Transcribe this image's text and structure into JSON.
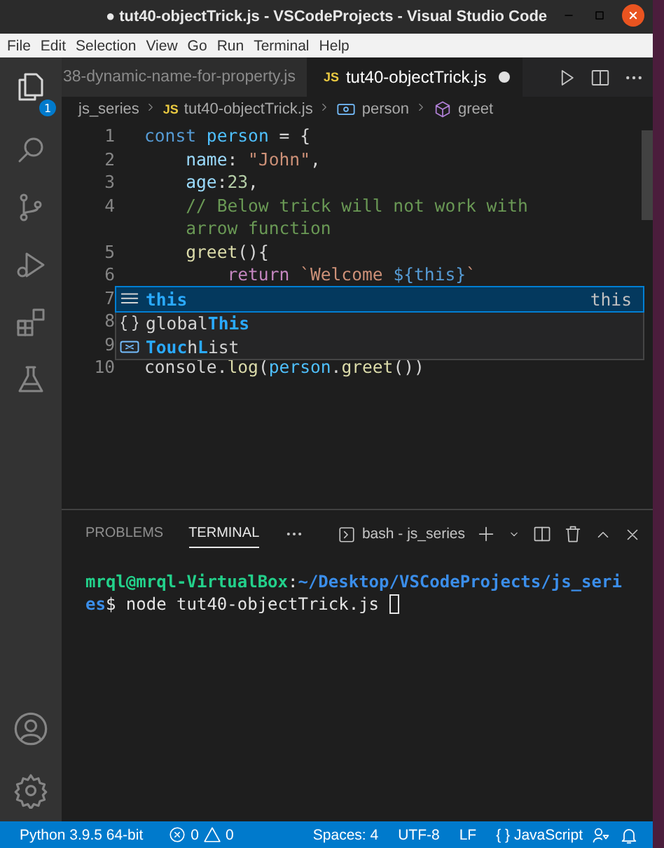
{
  "window": {
    "title": "● tut40-objectTrick.js - VSCodeProjects - Visual Studio Code"
  },
  "menu": [
    "File",
    "Edit",
    "Selection",
    "View",
    "Go",
    "Run",
    "Terminal",
    "Help"
  ],
  "activity_bar": {
    "explorer_badge": "1"
  },
  "tabs": [
    {
      "label": "38-dynamic-name-for-property.js",
      "selected": false,
      "modified": false
    },
    {
      "label": "tut40-objectTrick.js",
      "badge": "JS",
      "selected": true,
      "modified": true
    }
  ],
  "breadcrumb": [
    {
      "kind": "folder",
      "text": "js_series"
    },
    {
      "kind": "file",
      "badge": "JS",
      "text": "tut40-objectTrick.js"
    },
    {
      "kind": "variable",
      "text": "person"
    },
    {
      "kind": "method",
      "text": "greet"
    }
  ],
  "code": [
    {
      "number": "1",
      "tokens": [
        {
          "kind": "keyword",
          "text": "const"
        },
        {
          "kind": "constant",
          "text": " person"
        },
        {
          "kind": "plain",
          "text": " = {"
        }
      ]
    },
    {
      "number": "2",
      "tokens": [
        {
          "kind": "property",
          "text": "    name"
        },
        {
          "kind": "plain",
          "text": ": "
        },
        {
          "kind": "string",
          "text": "\"John\""
        },
        {
          "kind": "plain",
          "text": ","
        }
      ]
    },
    {
      "number": "3",
      "tokens": [
        {
          "kind": "property",
          "text": "    age"
        },
        {
          "kind": "plain",
          "text": ":"
        },
        {
          "kind": "number",
          "text": "23"
        },
        {
          "kind": "plain",
          "text": ","
        }
      ]
    },
    {
      "number": "4",
      "tokens": [
        {
          "kind": "comment",
          "text": "    // Below trick will not work with"
        }
      ]
    },
    {
      "tokens": [
        {
          "kind": "comment",
          "text": "    arrow function"
        }
      ]
    },
    {
      "number": "5",
      "tokens": [
        {
          "kind": "function",
          "text": "    greet"
        },
        {
          "kind": "plain",
          "text": "(){"
        }
      ]
    },
    {
      "number": "6",
      "tokens": [
        {
          "kind": "control",
          "text": "        return"
        },
        {
          "kind": "string",
          "text": " `Welcome "
        },
        {
          "kind": "keyword",
          "text": "${this}"
        },
        {
          "kind": "string",
          "text": "`"
        }
      ]
    },
    {
      "number": "7"
    },
    {
      "number": "8"
    },
    {
      "number": "9"
    },
    {
      "number": "10",
      "tokens": [
        {
          "kind": "plain",
          "text": "console"
        },
        {
          "kind": "plain",
          "text": "."
        },
        {
          "kind": "function",
          "text": "log"
        },
        {
          "kind": "plain",
          "text": "("
        },
        {
          "kind": "constant",
          "text": "person"
        },
        {
          "kind": "plain",
          "text": "."
        },
        {
          "kind": "function",
          "text": "greet"
        },
        {
          "kind": "plain",
          "text": "())"
        }
      ]
    }
  ],
  "suggestions": [
    {
      "kind": "keyword",
      "selected": true,
      "parts": [
        {
          "text": "this",
          "match": true
        }
      ],
      "detail": "this"
    },
    {
      "kind": "module",
      "selected": false,
      "parts": [
        {
          "text": "global",
          "match": false
        },
        {
          "text": "This",
          "match": true
        }
      ]
    },
    {
      "kind": "variable",
      "selected": false,
      "parts": [
        {
          "text": "Touc",
          "match": true
        },
        {
          "text": "h",
          "match": false
        },
        {
          "text": "L",
          "match": true
        },
        {
          "text": "ist",
          "match": false
        }
      ]
    }
  ],
  "panel": {
    "tabs": [
      {
        "label": "PROBLEMS",
        "selected": false
      },
      {
        "label": "TERMINAL",
        "selected": true
      }
    ],
    "terminal_picker": "bash - js_series",
    "terminal": [
      [
        {
          "kind": "user",
          "text": "mrql@mrql-VirtualBox"
        },
        {
          "kind": "plain",
          "text": ":"
        },
        {
          "kind": "path",
          "text": "~/Desktop/VSCodeProjects/js_seri"
        }
      ],
      [
        {
          "kind": "path",
          "text": "es"
        },
        {
          "kind": "plain",
          "text": "$ node tut40-objectTrick.js "
        }
      ]
    ]
  },
  "status_bar": {
    "interpreter": "Python 3.9.5 64-bit",
    "errors": "0",
    "warnings": "0",
    "indent": "Spaces: 4",
    "encoding": "UTF-8",
    "eol": "LF",
    "language_icon": "{ }",
    "language": "JavaScript"
  }
}
